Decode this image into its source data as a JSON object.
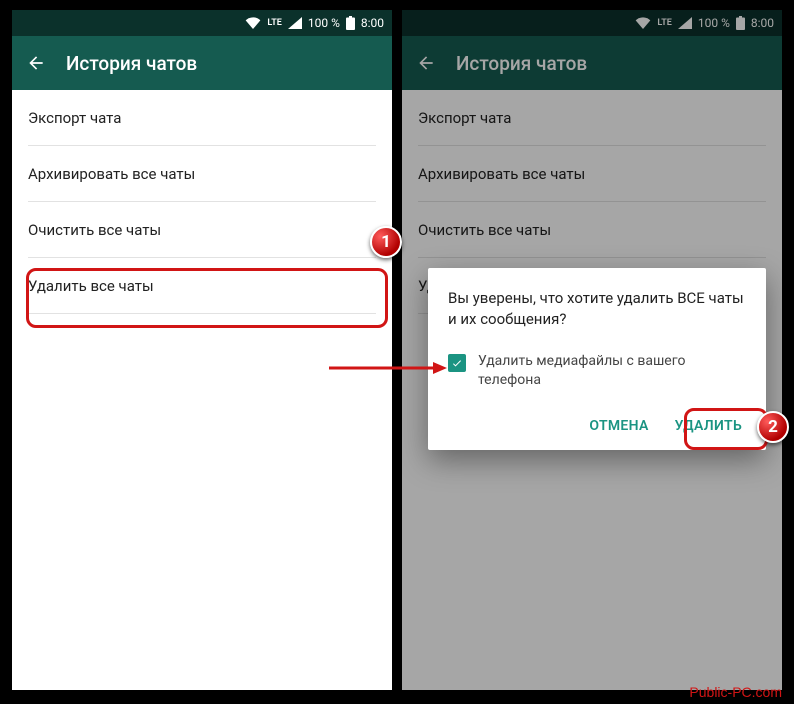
{
  "status": {
    "lte": "LTE",
    "battery_pct": "100 %",
    "time": "8:00"
  },
  "header": {
    "title": "История чатов"
  },
  "list": {
    "export_chat": "Экспорт чата",
    "archive_all": "Архивировать все чаты",
    "clear_all": "Очистить все чаты",
    "delete_all": "Удалить все чаты"
  },
  "dialog": {
    "title": "Вы уверены, что хотите удалить ВСЕ чаты и их сообщения?",
    "check_label": "Удалить медиафайлы с вашего телефона",
    "cancel": "ОТМЕНА",
    "confirm": "УДАЛИТЬ"
  },
  "badges": {
    "one": "1",
    "two": "2"
  },
  "watermark": "Public-PC.com"
}
